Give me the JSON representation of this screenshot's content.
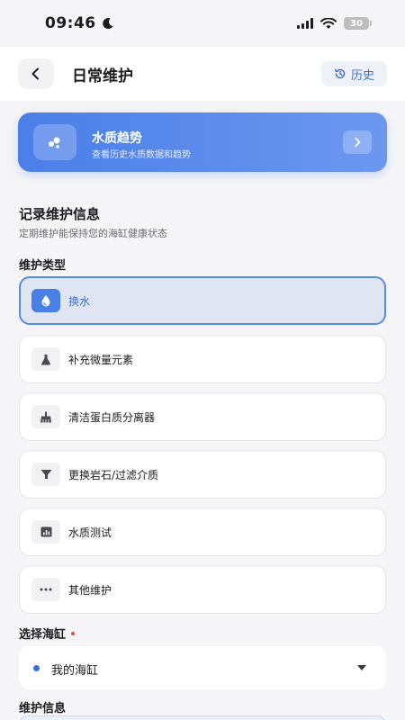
{
  "status_bar": {
    "time": "09:46",
    "battery": "30"
  },
  "nav": {
    "title": "日常维护",
    "history_label": "历史"
  },
  "banner": {
    "title": "水质趋势",
    "subtitle": "查看历史水质数据和趋势"
  },
  "record": {
    "title": "记录维护信息",
    "description": "定期维护能保持您的海缸健康状态",
    "type_label": "维护类型",
    "options": [
      {
        "label": "换水",
        "icon": "water-drop-icon",
        "selected": true
      },
      {
        "label": "补充微量元素",
        "icon": "flask-icon",
        "selected": false
      },
      {
        "label": "清洁蛋白质分离器",
        "icon": "cleaning-brush-icon",
        "selected": false
      },
      {
        "label": "更换岩石/过滤介质",
        "icon": "filter-icon",
        "selected": false
      },
      {
        "label": "水质测试",
        "icon": "chart-icon",
        "selected": false
      },
      {
        "label": "其他维护",
        "icon": "more-dots-icon",
        "selected": false
      }
    ]
  },
  "tank": {
    "label": "选择海缸",
    "value": "我的海缸"
  },
  "info": {
    "label": "维护信息"
  },
  "colors": {
    "accent": "#4a7fe8",
    "background": "#f5f5f7",
    "required": "#e74c3c"
  }
}
